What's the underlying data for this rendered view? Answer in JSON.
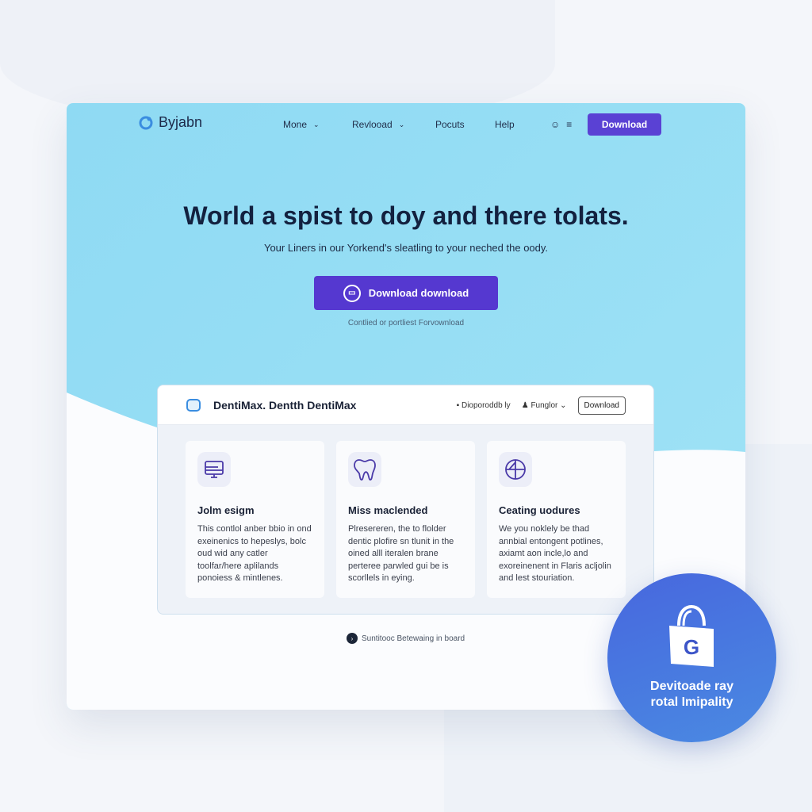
{
  "nav": {
    "brand": "Byjabn",
    "items": [
      {
        "label": "Mone",
        "dropdown": true
      },
      {
        "label": "Revlooad",
        "dropdown": true
      },
      {
        "label": "Pocuts",
        "dropdown": false
      },
      {
        "label": "Help",
        "dropdown": false
      }
    ],
    "download": "Download"
  },
  "hero": {
    "title": "World a spist to doy and there tolats.",
    "subtitle": "Your Liners in our Yorkend's sleatling to your neched the oody.",
    "cta": "Download download",
    "note": "Contlied or portliest Forvownload"
  },
  "panel": {
    "title": "DentiMax. Dentth DentiMax",
    "link1": "Dioporoddb ly",
    "link2": "Funglor",
    "download": "Download",
    "cards": [
      {
        "icon": "monitor-icon",
        "title": "Jolm esigm",
        "text": "This contlol anber bbio in ond exeinenics to hepeslys, bolc oud wid any catler toolfar/here aplilands ponoiess & mintlenes."
      },
      {
        "icon": "tooth-icon",
        "title": "Miss maclended",
        "text": "Plresereren, the to flolder dentic plofire sn tlunit in the oined alll iteralen brane perteree parwled gui be is scorllels in eying."
      },
      {
        "icon": "globe-icon",
        "title": "Ceating uodures",
        "text": "We you noklely be thad annbial entongent potlines, axiamt aon incle,lo and exoreinenent in Flaris acljolin and lest stouriation."
      }
    ]
  },
  "status": "Suntitooc Betewaing in board",
  "badge": {
    "line1": "Devitoade ray",
    "line2": "rotal Imipality",
    "icon": "shopping-bag-icon"
  },
  "colors": {
    "accent": "#5538d0",
    "hero": "#92ddf4",
    "badge": "#4a78e0"
  }
}
